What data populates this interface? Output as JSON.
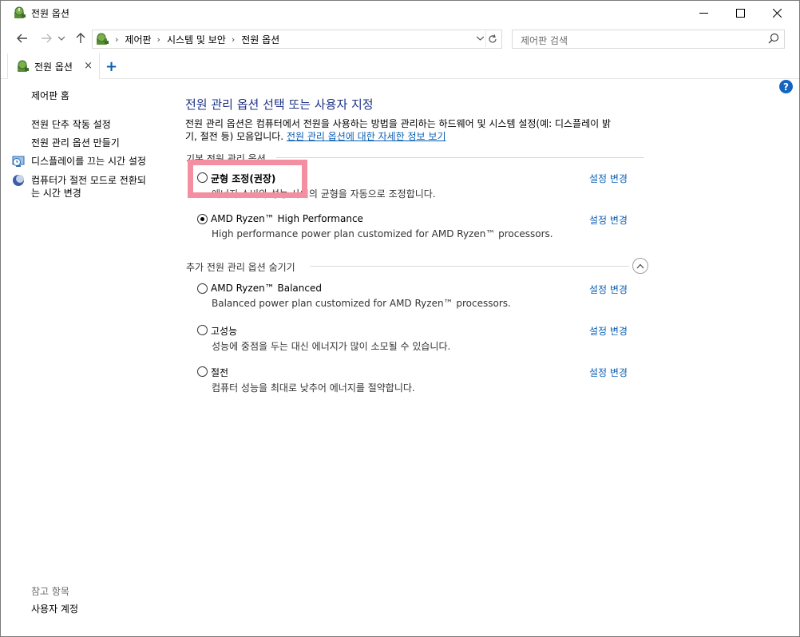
{
  "window": {
    "title": "전원 옵션",
    "buttons": {
      "minimize": "—",
      "maximize": "☐",
      "close": "✕"
    }
  },
  "nav": {
    "back": "←",
    "forward": "→",
    "recent": "⌄",
    "up": "↑",
    "breadcrumbs": [
      "제어판",
      "시스템 및 보안",
      "전원 옵션"
    ],
    "separator": "›",
    "dropdown": "⌄",
    "refresh": "↻",
    "search_placeholder": "제어판 검색"
  },
  "tabs": {
    "items": [
      {
        "label": "전원 옵션",
        "close": "×"
      }
    ],
    "add": "+"
  },
  "help": "?",
  "sidebar": {
    "home": "제어판 홈",
    "items": [
      {
        "label": "전원 단추 작동 설정"
      },
      {
        "label": "전원 관리 옵션 만들기"
      },
      {
        "label": "디스플레이를 끄는 시간 설정"
      },
      {
        "label": "컴퓨터가 절전 모드로 전환되는 시간 변경",
        "line1": "컴퓨터가 절전 모드로 전환되",
        "line2": "는 시간 변경"
      }
    ],
    "see_also": "참고 항목",
    "see_also_items": [
      {
        "label": "사용자 계정"
      }
    ]
  },
  "main": {
    "title": "전원 관리 옵션 선택 또는 사용자 지정",
    "description_line1": "전원 관리 옵션은 컴퓨터에서 전원을 사용하는 방법을 관리하는 하드웨어 및 시스템 설정(예: 디스플레이 밝",
    "description_line2": "기, 절전 등) 모음입니다.",
    "description_link": "전원 관리 옵션에 대한 자세한 정보 보기",
    "preferred_group": "기본 전원 관리 옵션",
    "preferred_plans": [
      {
        "name": "균형 조정(권장)",
        "desc": "에너지 소비와 성능 사이의 균형을 자동으로 조정합니다.",
        "link": "설정 변경",
        "selected": false
      },
      {
        "name": "AMD Ryzen™ High Performance",
        "desc": "High performance power plan customized for AMD Ryzen™ processors.",
        "link": "설정 변경",
        "selected": true
      }
    ],
    "extra_group": "추가 전원 관리 옵션 숨기기",
    "extra_plans": [
      {
        "name": "AMD Ryzen™ Balanced",
        "desc": "Balanced power plan customized for AMD Ryzen™ processors.",
        "link": "설정 변경",
        "selected": false
      },
      {
        "name": "고성능",
        "desc": "성능에 중점을 두는 대신 에너지가 많이 소모될 수 있습니다.",
        "link": "설정 변경",
        "selected": false
      },
      {
        "name": "절전",
        "desc": "컴퓨터 성능을 최대로 낮추어 에너지를 절약합니다.",
        "link": "설정 변경",
        "selected": false
      }
    ]
  },
  "colors": {
    "link": "#0b5fb4",
    "title": "#1e3287",
    "highlight": "#f48fa1",
    "help_badge": "#1565c0"
  }
}
